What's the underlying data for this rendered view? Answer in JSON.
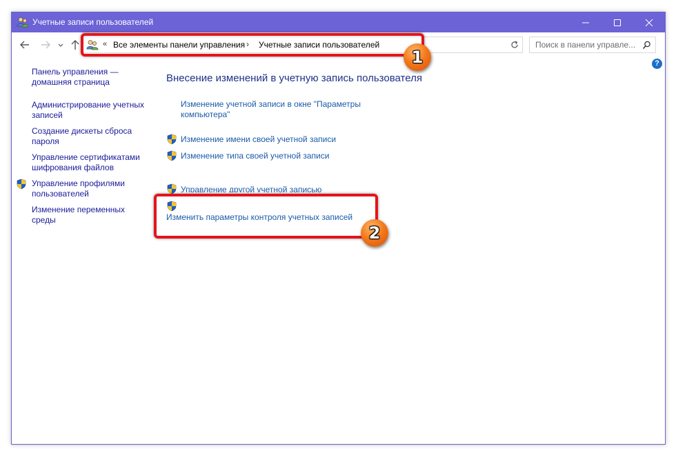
{
  "window": {
    "title": "Учетные записи пользователей"
  },
  "address_bar": {
    "overflow_chevron": "«",
    "crumbs": [
      "Все элементы панели управления",
      "Учетные записи пользователей"
    ],
    "separator": "›"
  },
  "search": {
    "placeholder": "Поиск в панели управле..."
  },
  "help": {
    "label": "?"
  },
  "sidebar": {
    "home": "Панель управления — домашняя страница",
    "items": [
      {
        "label": "Администрирование учетных записей",
        "shield": false
      },
      {
        "label": "Создание дискеты сброса пароля",
        "shield": false
      },
      {
        "label": "Управление сертификатами шифрования файлов",
        "shield": false
      },
      {
        "label": "Управление профилями пользователей",
        "shield": true
      },
      {
        "label": "Изменение переменных среды",
        "shield": false
      }
    ]
  },
  "main": {
    "title": "Внесение изменений в учетную запись пользователя",
    "links": [
      {
        "label": "Изменение учетной записи в окне \"Параметры компьютера\"",
        "shield": false
      },
      {
        "label": "Изменение имени своей учетной записи",
        "shield": true
      },
      {
        "label": "Изменение типа своей учетной записи",
        "shield": true
      },
      {
        "label": "Управление другой учетной записью",
        "shield": true
      },
      {
        "label": "Изменить параметры контроля учетных записей",
        "shield": true
      }
    ]
  },
  "annotations": {
    "badge1": "1",
    "badge2": "2",
    "callout_color": "#e3141b",
    "badge_color": "#f47a1c"
  },
  "colors": {
    "titlebar": "#6b63d6",
    "link": "#1a5aa9",
    "heading": "#1e3287"
  }
}
